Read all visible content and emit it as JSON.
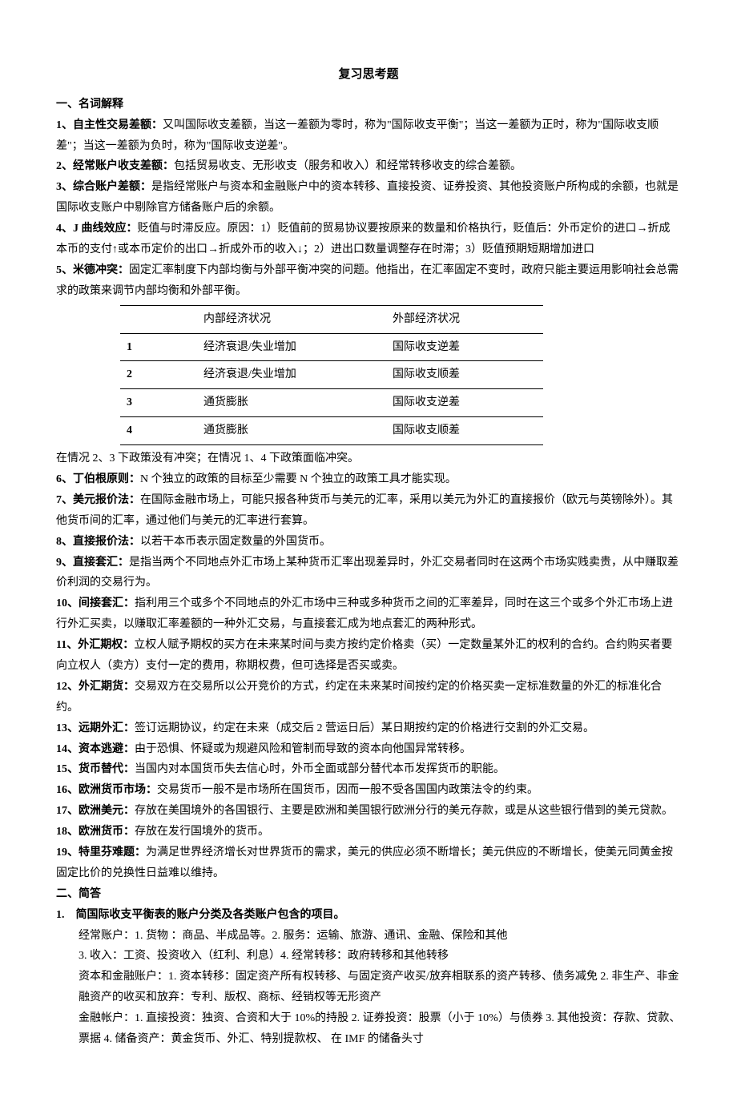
{
  "title": "复习思考题",
  "sections": {
    "s1": {
      "head": "一、名词解释",
      "terms": {
        "t1_label": "1、自主性交易差额：",
        "t1_text": "又叫国际收支差额，当这一差额为零时，称为\"国际收支平衡\"；当这一差额为正时，称为\"国际收支顺差\"；当这一差额为负时，称为\"国际收支逆差\"。",
        "t2_label": "2、经常账户收支差额：",
        "t2_text": "包括贸易收支、无形收支（服务和收入）和经常转移收支的综合差额。",
        "t3_label": "3、综合账户差额：",
        "t3_text": "是指经常账户与资本和金融账户中的资本转移、直接投资、证券投资、其他投资账户所构成的余额，也就是国际收支账户中剔除官方储备账户后的余额。",
        "t4_label": "4、J 曲线效应：",
        "t4_text": "贬值与时滞反应。原因：1）贬值前的贸易协议要按原来的数量和价格执行，贬值后：外币定价的进口→折成本币的支付↑或本币定价的出口→折成外币的收入↓；2）进出口数量调整存在时滞；3）贬值预期短期增加进口",
        "t5_label": "5、米德冲突：",
        "t5_text": "固定汇率制度下内部均衡与外部平衡冲突的问题。他指出，在汇率固定不变时，政府只能主要运用影响社会总需求的政策来调节内部均衡和外部平衡。",
        "table_note": "在情况 2、3 下政策没有冲突；在情况 1、4 下政策面临冲突。",
        "t6_label": "6、丁伯根原则：",
        "t6_text": "N 个独立的政策的目标至少需要 N 个独立的政策工具才能实现。",
        "t7_label": "7、美元报价法：",
        "t7_text": "在国际金融市场上，可能只报各种货币与美元的汇率，采用以美元为外汇的直接报价（欧元与英镑除外）。其他货币间的汇率，通过他们与美元的汇率进行套算。",
        "t8_label": "8、直接报价法：",
        "t8_text": "以若干本币表示固定数量的外国货币。",
        "t9_label": "9、直接套汇：",
        "t9_text": "是指当两个不同地点外汇市场上某种货币汇率出现差异时，外汇交易者同时在这两个市场实贱卖贵，从中赚取差价利润的交易行为。",
        "t10_label": "10、间接套汇：",
        "t10_text": "指利用三个或多个不同地点的外汇市场中三种或多种货币之间的汇率差异，同时在这三个或多个外汇市场上进行外汇买卖，以赚取汇率差额的一种外汇交易，与直接套汇成为地点套汇的两种形式。",
        "t11_label": "11、外汇期权：",
        "t11_text": "立权人赋予期权的买方在未来某时间与卖方按约定价格卖（买）一定数量某外汇的权利的合约。合约购买者要向立权人（卖方）支付一定的费用，称期权费，但可选择是否买或卖。",
        "t12_label": "12、外汇期货：",
        "t12_text": "交易双方在交易所以公开竞价的方式，约定在未来某时间按约定的价格买卖一定标准数量的外汇的标准化合约。",
        "t13_label": "13、远期外汇：",
        "t13_text": "签订远期协议，约定在未来（成交后 2 营运日后）某日期按约定的价格进行交割的外汇交易。",
        "t14_label": "14、资本逃避：",
        "t14_text": "由于恐惧、怀疑或为规避风险和管制而导致的资本向他国异常转移。",
        "t15_label": "15、货币替代：",
        "t15_text": "当国内对本国货币失去信心时，外币全面或部分替代本币发挥货币的职能。",
        "t16_label": "16、欧洲货币市场：",
        "t16_text": "交易货币一般不是市场所在国货币，因而一般不受各国国内政策法令的约束。",
        "t17_label": "17、欧洲美元：",
        "t17_text": "存放在美国境外的各国银行、主要是欧洲和美国银行欧洲分行的美元存款，或是从这些银行借到的美元贷款。",
        "t18_label": "18、欧洲货币：",
        "t18_text": "存放在发行国境外的货币。",
        "t19_label": "19、特里芬难题：",
        "t19_text": "为满足世界经济增长对世界货币的需求，美元的供应必须不断增长；美元供应的不断增长，使美元同黄金按固定比价的兑换性日益难以维持。"
      },
      "table": {
        "head_idx": "",
        "head_int": "内部经济状况",
        "head_ext": "外部经济状况",
        "rows": [
          {
            "idx": "1",
            "internal": "经济衰退/失业增加",
            "external": "国际收支逆差"
          },
          {
            "idx": "2",
            "internal": "经济衰退/失业增加",
            "external": "国际收支顺差"
          },
          {
            "idx": "3",
            "internal": "通货膨胀",
            "external": "国际收支逆差"
          },
          {
            "idx": "4",
            "internal": "通货膨胀",
            "external": "国际收支顺差"
          }
        ]
      }
    },
    "s2": {
      "head": "二、简答",
      "q1_head": "1.　简国际收支平衡表的账户分类及各类账户包含的项目。",
      "q1_lines": {
        "l1": "经常账户：1. 货物 ：商品、半成品等。2. 服务：运输、旅游、通讯、金融、保险和其他",
        "l2": "3. 收入：工资、投资收入（红利、利息）4. 经常转移：政府转移和其他转移",
        "l3": "资本和金融账户：1. 资本转移：固定资产所有权转移、与固定资产收买/放弃相联系的资产转移、债务减免 2. 非生产、非金融资产的收买和放弃：专利、版权、商标、经销权等无形资产",
        "l4": "金融帐户：1. 直接投资：独资、合资和大于 10%的持股 2. 证券投资：股票（小于 10%）与债券 3. 其他投资：存款、贷款、票据 4. 储备资产：黄金货币、外汇、特别提款权、 在 IMF 的储备头寸"
      }
    }
  }
}
